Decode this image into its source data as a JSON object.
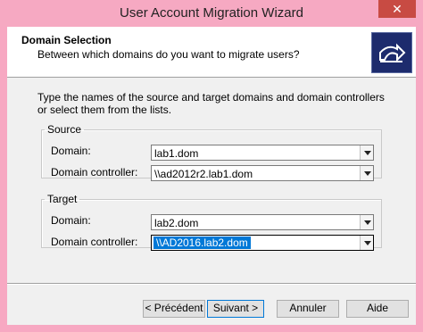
{
  "window": {
    "title": "User Account Migration Wizard",
    "close": "✕"
  },
  "header": {
    "title": "Domain Selection",
    "subtitle": "Between which domains do you want to migrate users?"
  },
  "intro": "Type the names of the source and target domains and domain controllers or select them from the lists.",
  "source": {
    "legend": "Source",
    "domain_label": "Domain:",
    "domain_value": "lab1.dom",
    "dc_label": "Domain controller:",
    "dc_value": "\\\\ad2012r2.lab1.dom"
  },
  "target": {
    "legend": "Target",
    "domain_label": "Domain:",
    "domain_value": "lab2.dom",
    "dc_label": "Domain controller:",
    "dc_value": "\\\\AD2016.lab2.dom"
  },
  "buttons": {
    "back": "< Précédent",
    "next": "Suivant >",
    "cancel": "Annuler",
    "help": "Aide"
  },
  "colors": {
    "title_bar": "#f6a9c2",
    "close_button": "#c84b43",
    "logo_bg": "#1d2b6d",
    "selection": "#0078d7"
  },
  "icons": {
    "logo": "migration-wizard-logo-icon"
  }
}
